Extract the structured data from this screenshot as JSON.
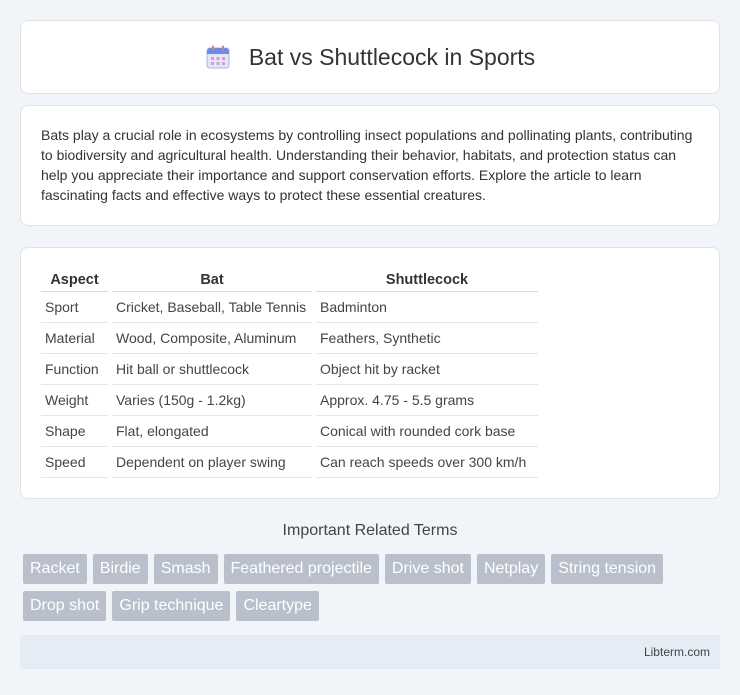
{
  "header": {
    "title": "Bat vs Shuttlecock in Sports",
    "icon": "calendar-icon"
  },
  "intro": {
    "text": "Bats play a crucial role in ecosystems by controlling insect populations and pollinating plants, contributing to biodiversity and agricultural health. Understanding their behavior, habitats, and protection status can help you appreciate their importance and support conservation efforts. Explore the article to learn fascinating facts and effective ways to protect these essential creatures."
  },
  "table": {
    "headers": [
      "Aspect",
      "Bat",
      "Shuttlecock"
    ],
    "rows": [
      [
        "Sport",
        "Cricket, Baseball, Table Tennis",
        "Badminton"
      ],
      [
        "Material",
        "Wood, Composite, Aluminum",
        "Feathers, Synthetic"
      ],
      [
        "Function",
        "Hit ball or shuttlecock",
        "Object hit by racket"
      ],
      [
        "Weight",
        "Varies (150g - 1.2kg)",
        "Approx. 4.75 - 5.5 grams"
      ],
      [
        "Shape",
        "Flat, elongated",
        "Conical with rounded cork base"
      ],
      [
        "Speed",
        "Dependent on player swing",
        "Can reach speeds over 300 km/h"
      ]
    ]
  },
  "terms": {
    "title": "Important Related Terms",
    "items": [
      "Racket",
      "Birdie",
      "Smash",
      "Feathered projectile",
      "Drive shot",
      "Netplay",
      "String tension",
      "Drop shot",
      "Grip technique",
      "Cleartype"
    ]
  },
  "footer": {
    "brand": "Libterm.com"
  },
  "colors": {
    "tag_bg": "#b9c0cb",
    "footer_bg": "#e6ecf6",
    "page_bg": "#f1f4f8"
  }
}
